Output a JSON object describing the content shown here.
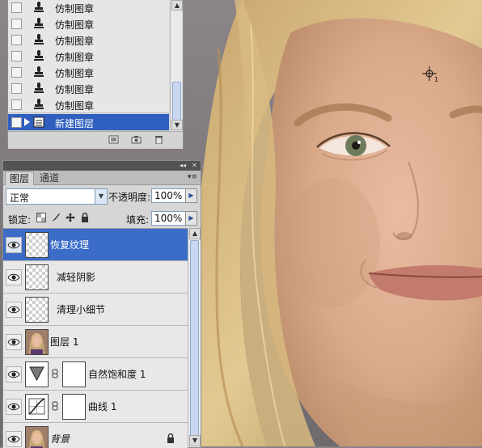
{
  "history": {
    "items": [
      {
        "label": "仿制图章",
        "icon": "clone-stamp-icon"
      },
      {
        "label": "仿制图章",
        "icon": "clone-stamp-icon"
      },
      {
        "label": "仿制图章",
        "icon": "clone-stamp-icon"
      },
      {
        "label": "仿制图章",
        "icon": "clone-stamp-icon"
      },
      {
        "label": "仿制图章",
        "icon": "clone-stamp-icon"
      },
      {
        "label": "仿制图章",
        "icon": "clone-stamp-icon"
      },
      {
        "label": "仿制图章",
        "icon": "clone-stamp-icon"
      },
      {
        "label": "新建图层",
        "icon": "new-layer-icon",
        "selected": true
      }
    ],
    "bottom_icons": [
      "new-document-from-state-icon",
      "snapshot-icon",
      "trash-icon"
    ]
  },
  "layers_panel": {
    "tabs": [
      {
        "label": "图层",
        "active": true
      },
      {
        "label": "通道",
        "active": false
      }
    ],
    "blend_mode": "正常",
    "opacity_label": "不透明度:",
    "opacity_value": "100%",
    "lock_label": "锁定:",
    "lock_icons": [
      "lock-transparent-icon",
      "lock-brush-icon",
      "lock-move-icon",
      "lock-all-icon"
    ],
    "fill_label": "填充:",
    "fill_value": "100%",
    "layers": [
      {
        "name": "恢复纹理",
        "type": "pixel",
        "selected": true
      },
      {
        "name": "减轻阴影",
        "type": "pixel"
      },
      {
        "name": "清理小细节",
        "type": "pixel"
      },
      {
        "name": "图层 1",
        "type": "photo"
      },
      {
        "name": "自然饱和度 1",
        "type": "adjustment-vibrance"
      },
      {
        "name": "曲线 1",
        "type": "adjustment-curves"
      },
      {
        "name": "背景",
        "type": "background",
        "locked": true
      }
    ]
  },
  "canvas": {
    "cursor": "clone-source-crosshair-icon",
    "cursor_subscript": "1"
  },
  "colors": {
    "selection": "#3a6cc8",
    "panel_bg": "#d6d6d6"
  }
}
